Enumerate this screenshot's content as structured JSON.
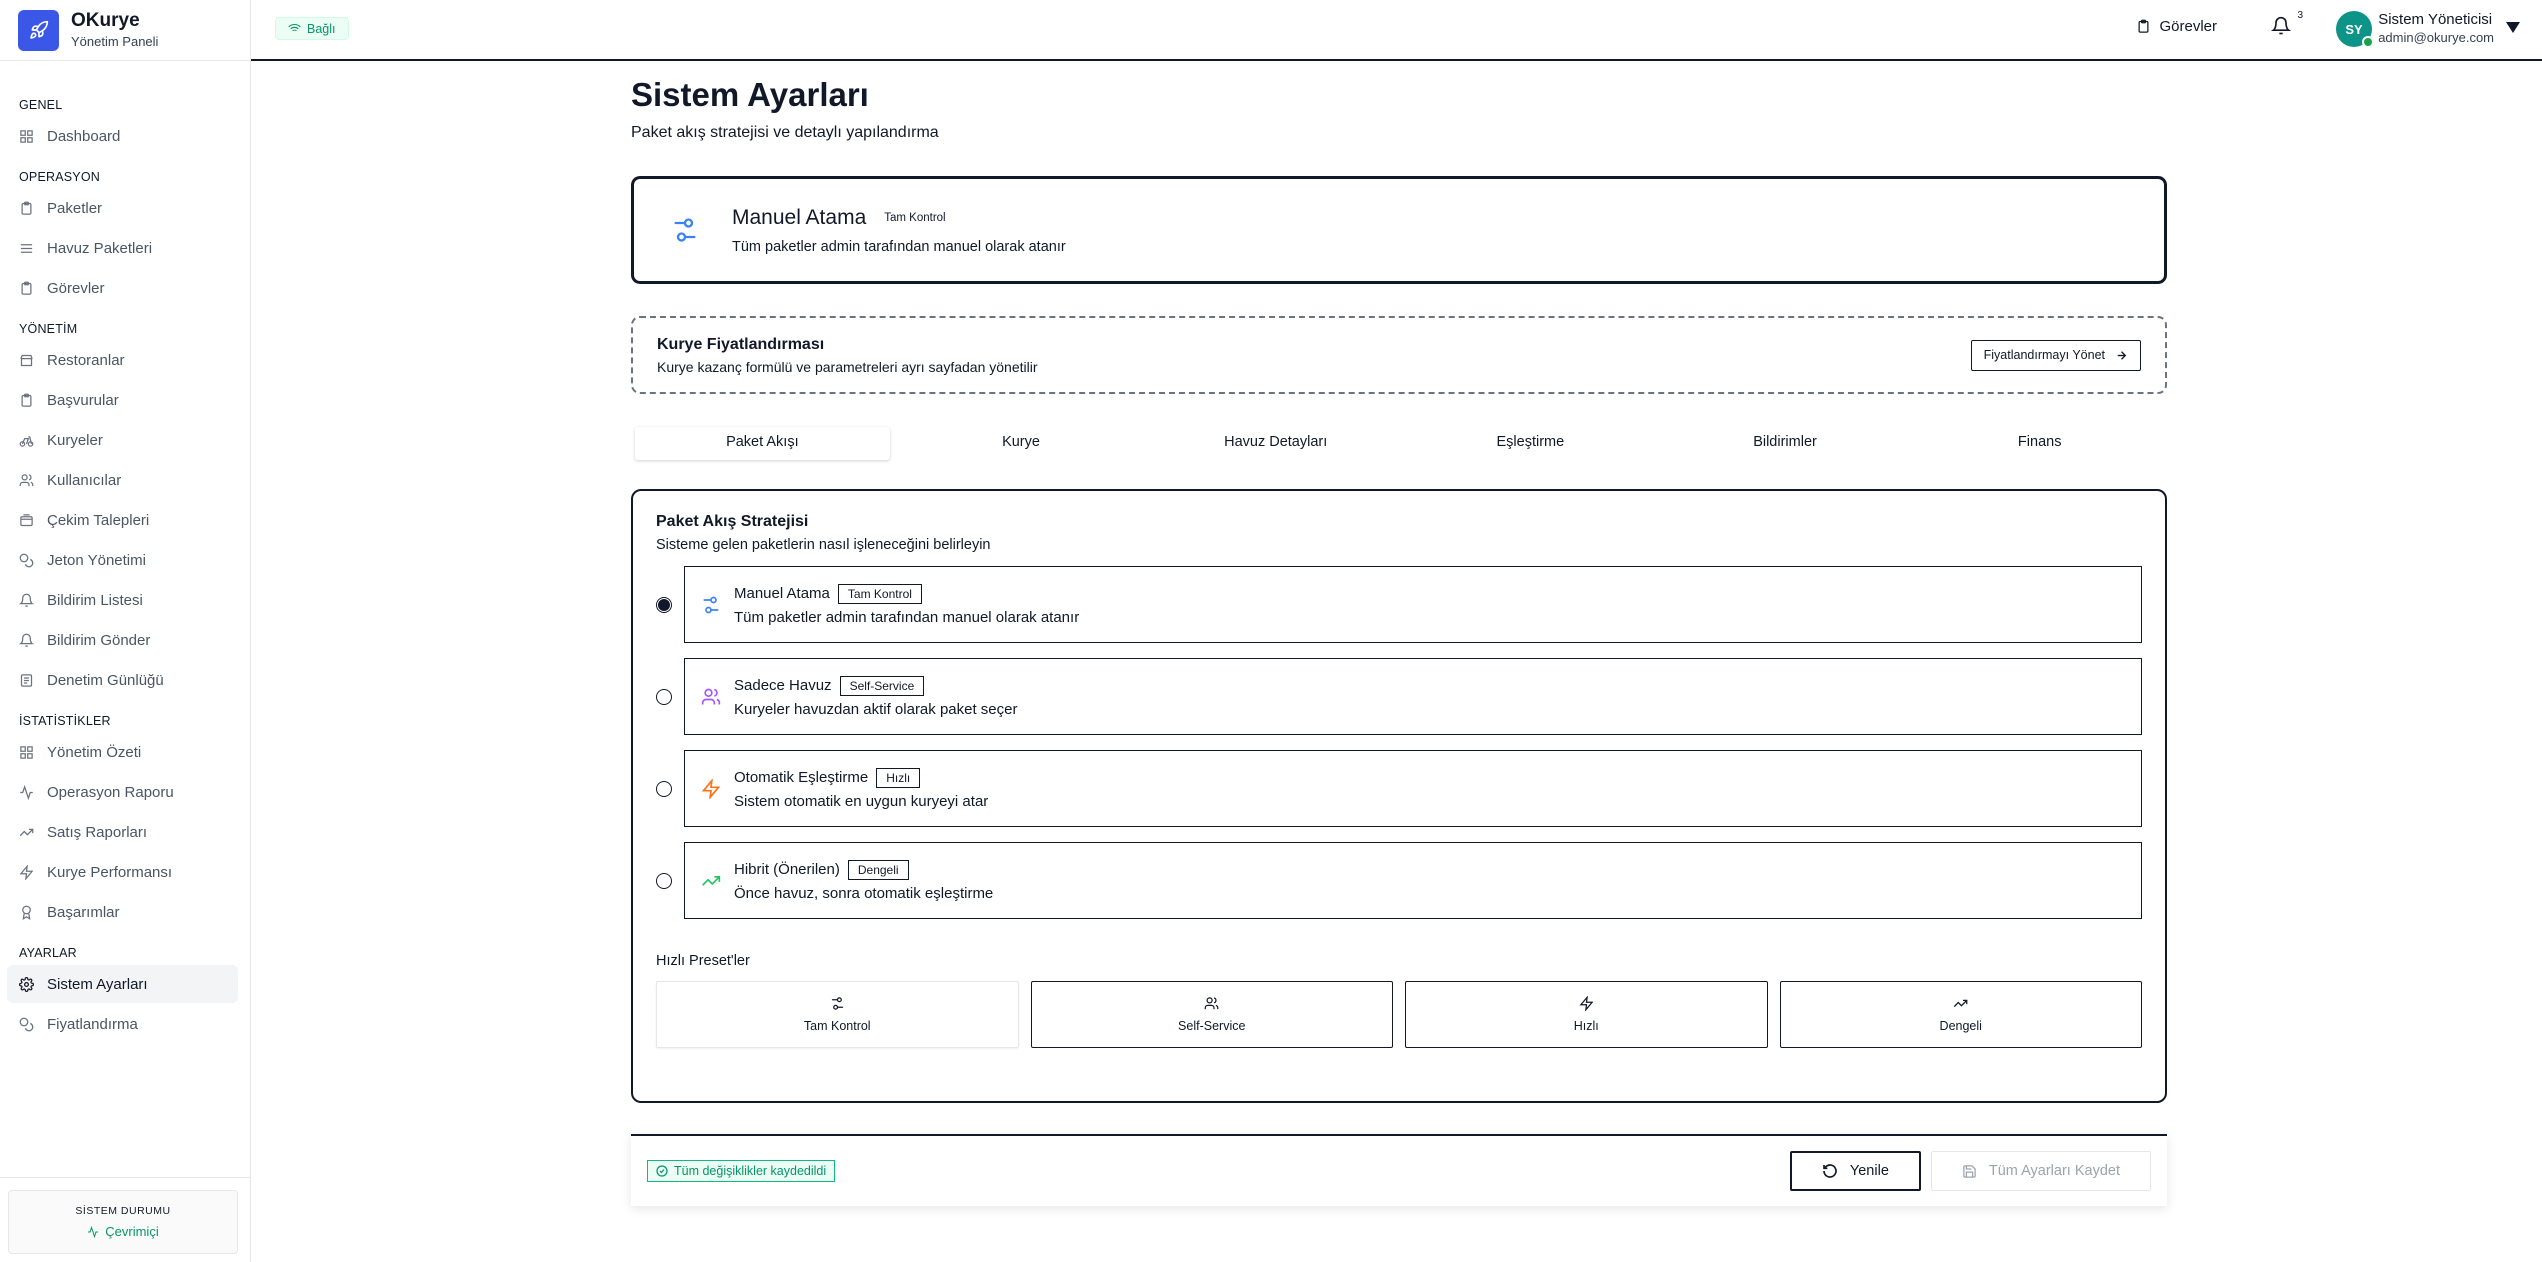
{
  "brand": {
    "name": "OKurye",
    "subtitle": "Yönetim Paneli"
  },
  "sidebar": {
    "sections": [
      {
        "title": "GENEL",
        "items": [
          {
            "label": "Dashboard",
            "icon": "grid-icon"
          }
        ]
      },
      {
        "title": "OPERASYON",
        "items": [
          {
            "label": "Paketler",
            "icon": "clipboard-icon"
          },
          {
            "label": "Havuz Paketleri",
            "icon": "lines-icon"
          },
          {
            "label": "Görevler",
            "icon": "clipboard-icon"
          }
        ]
      },
      {
        "title": "YÖNETİM",
        "items": [
          {
            "label": "Restoranlar",
            "icon": "store-icon"
          },
          {
            "label": "Başvurular",
            "icon": "clipboard-icon"
          },
          {
            "label": "Kuryeler",
            "icon": "bike-icon"
          },
          {
            "label": "Kullanıcılar",
            "icon": "users-icon"
          },
          {
            "label": "Çekim Talepleri",
            "icon": "wallet-icon"
          },
          {
            "label": "Jeton Yönetimi",
            "icon": "coins-icon"
          },
          {
            "label": "Bildirim Listesi",
            "icon": "list-icon"
          },
          {
            "label": "Bildirim Gönder",
            "icon": "bell-icon"
          },
          {
            "label": "Denetim Günlüğü",
            "icon": "log-icon"
          }
        ]
      },
      {
        "title": "İSTATİSTİKLER",
        "items": [
          {
            "label": "Yönetim Özeti",
            "icon": "grid-icon"
          },
          {
            "label": "Operasyon Raporu",
            "icon": "activity-icon"
          },
          {
            "label": "Satış Raporları",
            "icon": "trending-icon"
          },
          {
            "label": "Kurye Performansı",
            "icon": "zap-icon"
          },
          {
            "label": "Başarımlar",
            "icon": "award-icon"
          }
        ]
      },
      {
        "title": "AYARLAR",
        "items": [
          {
            "label": "Sistem Ayarları",
            "icon": "gear-icon",
            "active": true
          },
          {
            "label": "Fiyatlandırma",
            "icon": "coins-icon"
          }
        ]
      }
    ],
    "status": {
      "title": "SİSTEM DURUMU",
      "value": "Çevrimiçi"
    }
  },
  "topbar": {
    "connection": "Bağlı",
    "tasks": "Görevler",
    "notification_count": "3",
    "user": {
      "initials": "SY",
      "name": "Sistem Yöneticisi",
      "email": "admin@okurye.com"
    }
  },
  "page": {
    "title": "Sistem Ayarları",
    "subtitle": "Paket akış stratejisi ve detaylı yapılandırma",
    "current_mode": {
      "title": "Manuel Atama",
      "tag": "Tam Kontrol",
      "desc": "Tüm paketler admin tarafından manuel olarak atanır"
    },
    "pricing": {
      "title": "Kurye Fiyatlandırması",
      "desc": "Kurye kazanç formülü ve parametreleri ayrı sayfadan yönetilir",
      "button": "Fiyatlandırmayı Yönet"
    },
    "tabs": [
      "Paket Akışı",
      "Kurye",
      "Havuz Detayları",
      "Eşleştirme",
      "Bildirimler",
      "Finans"
    ],
    "flow": {
      "title": "Paket Akış Stratejisi",
      "desc": "Sisteme gelen paketlerin nasıl işleneceğini belirleyin",
      "options": [
        {
          "name": "Manuel Atama",
          "badge": "Tam Kontrol",
          "desc": "Tüm paketler admin tarafından manuel olarak atanır",
          "icon": "sliders-icon",
          "color": "#3b82f6",
          "checked": true
        },
        {
          "name": "Sadece Havuz",
          "badge": "Self-Service",
          "desc": "Kuryeler havuzdan aktif olarak paket seçer",
          "icon": "users-icon",
          "color": "#a855f7",
          "checked": false
        },
        {
          "name": "Otomatik Eşleştirme",
          "badge": "Hızlı",
          "desc": "Sistem otomatik en uygun kuryeyi atar",
          "icon": "zap-icon",
          "color": "#f97316",
          "checked": false
        },
        {
          "name": "Hibrit (Önerilen)",
          "badge": "Dengeli",
          "desc": "Önce havuz, sonra otomatik eşleştirme",
          "icon": "trending-icon",
          "color": "#22c55e",
          "checked": false
        }
      ],
      "presets_title": "Hızlı Preset'ler",
      "presets": [
        {
          "label": "Tam Kontrol",
          "icon": "sliders-icon"
        },
        {
          "label": "Self-Service",
          "icon": "users-icon"
        },
        {
          "label": "Hızlı",
          "icon": "zap-icon"
        },
        {
          "label": "Dengeli",
          "icon": "trending-icon"
        }
      ]
    },
    "savebar": {
      "status": "Tüm değişiklikler kaydedildi",
      "refresh": "Yenile",
      "save_all": "Tüm Ayarları Kaydet"
    }
  }
}
